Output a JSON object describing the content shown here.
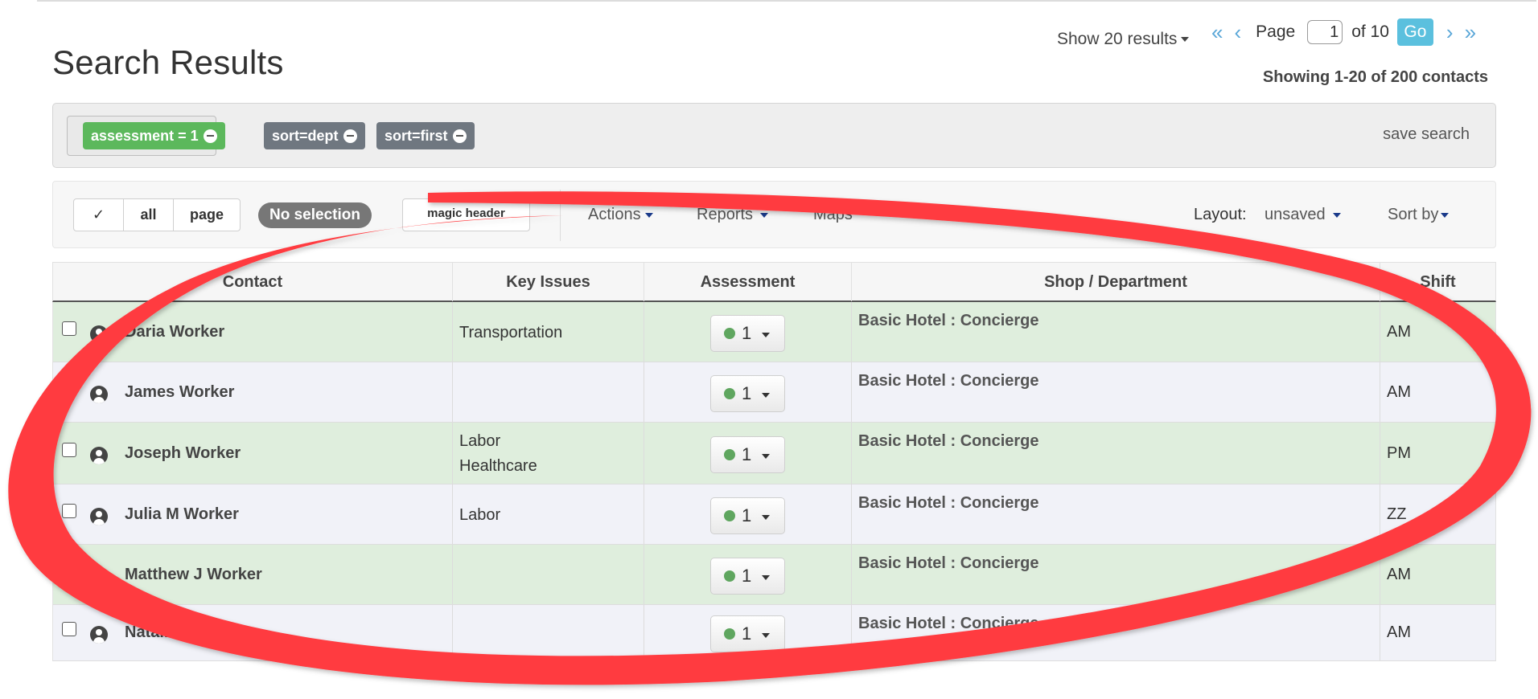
{
  "header": {
    "title": "Search Results",
    "show_results": "Show 20 results",
    "showing_summary": "Showing 1-20 of 200 contacts"
  },
  "pager": {
    "page_label": "Page",
    "current_page": "1",
    "of_label": "of 10",
    "go_label": "Go"
  },
  "filters": {
    "tags": [
      {
        "label": "assessment = 1",
        "color": "#5cb85c"
      },
      {
        "label": "sort=dept",
        "color": "#6f7780"
      },
      {
        "label": "sort=first",
        "color": "#6f7780"
      }
    ],
    "save_search": "save search"
  },
  "toolbar": {
    "select_check": "✓",
    "select_all": "all",
    "select_page": "page",
    "selection_status": "No selection",
    "magic_header": "magic header",
    "actions": "Actions",
    "reports": "Reports",
    "maps": "Maps",
    "layout_label": "Layout:",
    "layout_value": "unsaved",
    "sort_by": "Sort by"
  },
  "table": {
    "columns": [
      "Contact",
      "Key Issues",
      "Assessment",
      "Shop / Department",
      "Shift"
    ],
    "rows": [
      {
        "name": "Daria Worker",
        "issues": [
          "Transportation"
        ],
        "assessment": "1",
        "dept": "Basic Hotel : Concierge",
        "shift": "AM",
        "tint": "green"
      },
      {
        "name": "James Worker",
        "issues": [],
        "assessment": "1",
        "dept": "Basic Hotel : Concierge",
        "shift": "AM",
        "tint": "white"
      },
      {
        "name": "Joseph Worker",
        "issues": [
          "Labor",
          "Healthcare"
        ],
        "assessment": "1",
        "dept": "Basic Hotel : Concierge",
        "shift": "PM",
        "tint": "green"
      },
      {
        "name": "Julia M Worker",
        "issues": [
          "Labor"
        ],
        "assessment": "1",
        "dept": "Basic Hotel : Concierge",
        "shift": "ZZ",
        "tint": "white"
      },
      {
        "name": "Matthew J Worker",
        "issues": [],
        "assessment": "1",
        "dept": "Basic Hotel : Concierge",
        "shift": "AM",
        "tint": "green"
      },
      {
        "name": "Natalie A",
        "issues": [],
        "assessment": "1",
        "dept": "Basic Hotel : Concierge",
        "shift": "AM",
        "tint": "white"
      }
    ]
  },
  "annotation": {
    "color": "#ff3b3f",
    "shape": "hand-drawn-ellipse"
  }
}
